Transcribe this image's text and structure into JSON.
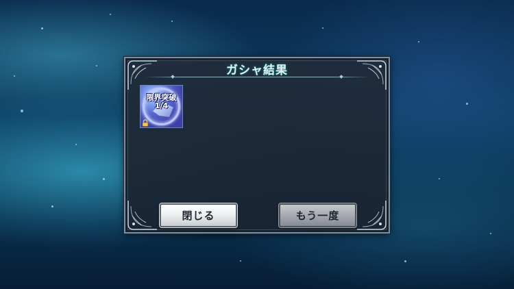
{
  "dialog": {
    "title": "ガシャ結果",
    "item": {
      "label_line1": "限界突破",
      "label_line2": "1/4",
      "icon": "limit-break-crystal-icon",
      "locked": true
    },
    "buttons": {
      "close_label": "閉じる",
      "again_label": "もう一度"
    }
  },
  "colors": {
    "title_glow": "#0f8a8a",
    "item_bg": "#3a3c9c",
    "close_button": "#ffffff",
    "again_button": "#a6aab0"
  }
}
